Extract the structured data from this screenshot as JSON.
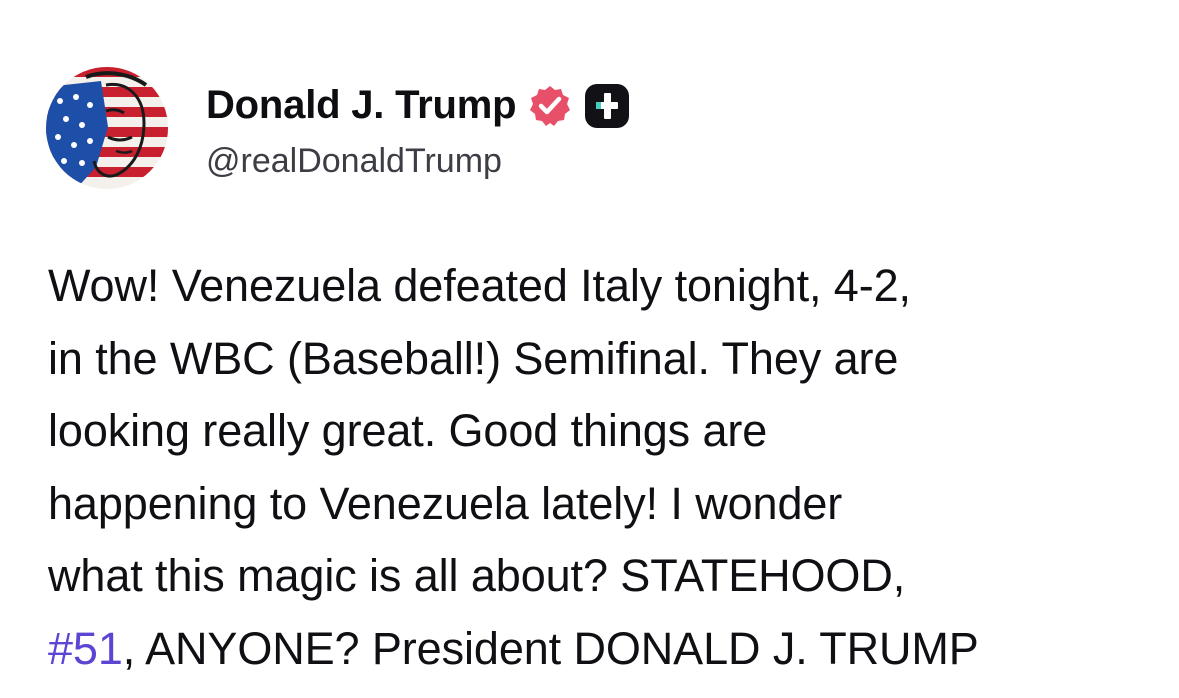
{
  "author": {
    "display_name": "Donald J. Trump",
    "handle": "@realDonaldTrump",
    "avatar_icon": "flag-portrait-avatar",
    "verified_icon": "verified-badge-icon",
    "plus_icon": "plus-badge-icon",
    "colors": {
      "verified": "#e8506a",
      "plus_badge_bg": "#111116",
      "plus_badge_fg": "#ffffff"
    }
  },
  "post": {
    "lines": [
      "Wow! Venezuela defeated Italy tonight, 4-2,",
      "in the WBC (Baseball!) Semifinal. They are",
      "looking really great. Good things are",
      "happening to Venezuela lately! I wonder",
      "what this magic is all about? STATEHOOD,"
    ],
    "last_line": {
      "hashtag": "#51",
      "rest": ", ANYONE? President DONALD J. TRUMP"
    },
    "colors": {
      "text": "#0f0f14",
      "hashtag": "#5b46d4"
    }
  }
}
